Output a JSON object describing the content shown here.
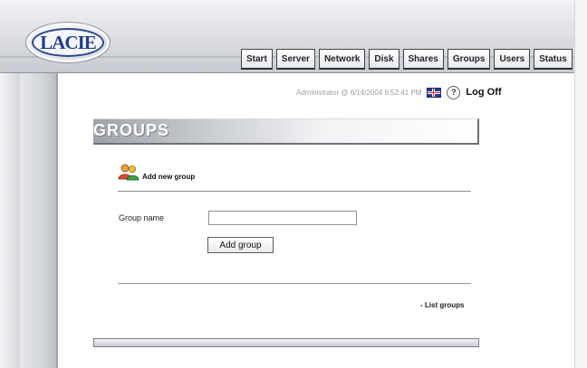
{
  "brand": {
    "logo_text": "LACIE"
  },
  "tabs": [
    "Start",
    "Server",
    "Network",
    "Disk",
    "Shares",
    "Groups",
    "Users",
    "Status"
  ],
  "status": {
    "user_time": "Administrator @ 6/14/2004 6:52:41 PM",
    "help_glyph": "?",
    "logoff_label": "Log Off"
  },
  "page": {
    "title": "GROUPS"
  },
  "add_group": {
    "heading": "Add new group",
    "field_label": "Group name",
    "field_value": "",
    "button_label": "Add group"
  },
  "links": {
    "list_groups": "- List groups"
  },
  "icons": {
    "logo": "lacie-logo",
    "language": "uk-flag-icon",
    "help": "help-icon",
    "add_group": "users-icon"
  },
  "colors": {
    "accent_blue": "#213f86",
    "title_text": "#ffffff"
  }
}
